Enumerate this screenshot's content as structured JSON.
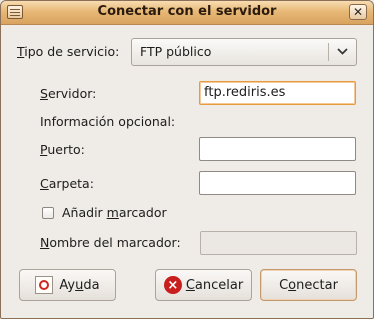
{
  "window": {
    "title": "Conectar con el servidor",
    "close_glyph": "✕",
    "icons": {
      "window_menu": "window-menu-icon",
      "close": "close-icon",
      "help": "help-icon",
      "cancel": "cancel-icon",
      "dropdown": "chevron-down-icon"
    }
  },
  "form": {
    "service_type": {
      "label_prefix": "",
      "label_access": "T",
      "label_rest": "ipo de servicio:",
      "value": "FTP público"
    },
    "server": {
      "label_access": "S",
      "label_rest": "ervidor:",
      "value": "ftp.rediris.es"
    },
    "optional_header": "Información opcional:",
    "port": {
      "label_access": "P",
      "label_rest": "uerto:",
      "value": ""
    },
    "folder": {
      "label_access": "C",
      "label_rest": "arpeta:",
      "value": ""
    },
    "add_bookmark": {
      "label_prefix": "Añadir ",
      "label_access": "m",
      "label_rest": "arcador",
      "checked": false
    },
    "bookmark_name": {
      "label_access": "N",
      "label_rest": "ombre del marcador:",
      "value": ""
    }
  },
  "buttons": {
    "help": {
      "label_prefix": "Ay",
      "label_access": "u",
      "label_rest": "da"
    },
    "cancel": {
      "label_access": "C",
      "label_rest": "ancelar"
    },
    "connect": {
      "label_prefix": "C",
      "label_access": "o",
      "label_rest": "nectar"
    }
  }
}
